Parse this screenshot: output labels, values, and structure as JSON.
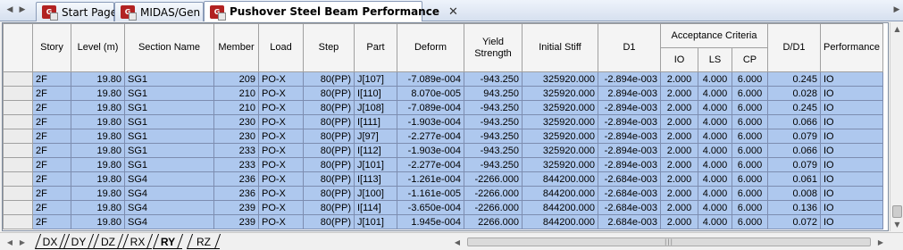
{
  "tabbar": {
    "nav_left": "◀",
    "nav_right": "▶",
    "tabs": [
      {
        "label": "Start Page",
        "icon": "midas-icon",
        "active": false
      },
      {
        "label": "MIDAS/Gen",
        "icon": "midas-icon",
        "active": false
      },
      {
        "label": "Pushover Steel Beam Performance",
        "icon": "midas-icon",
        "active": true
      }
    ],
    "close_glyph": "✕",
    "icon_text": "G"
  },
  "table": {
    "headers": {
      "story": "Story",
      "level": "Level (m)",
      "section": "Section Name",
      "member": "Member",
      "load": "Load",
      "step": "Step",
      "part": "Part",
      "deform": "Deform",
      "yield": "Yield Strength",
      "init_stiff": "Initial Stiff",
      "d1": "D1",
      "acceptance": "Acceptance Criteria",
      "io": "IO",
      "ls": "LS",
      "cp": "CP",
      "dd1": "D/D1",
      "performance": "Performance"
    },
    "rows": [
      [
        "2F",
        "19.80",
        "SG1",
        "209",
        "PO-X",
        "80(PP)",
        "J[107]",
        "-7.089e-004",
        "-943.250",
        "325920.000",
        "-2.894e-003",
        "2.000",
        "4.000",
        "6.000",
        "0.245",
        "IO"
      ],
      [
        "2F",
        "19.80",
        "SG1",
        "210",
        "PO-X",
        "80(PP)",
        "I[110]",
        "8.070e-005",
        "943.250",
        "325920.000",
        "2.894e-003",
        "2.000",
        "4.000",
        "6.000",
        "0.028",
        "IO"
      ],
      [
        "2F",
        "19.80",
        "SG1",
        "210",
        "PO-X",
        "80(PP)",
        "J[108]",
        "-7.089e-004",
        "-943.250",
        "325920.000",
        "-2.894e-003",
        "2.000",
        "4.000",
        "6.000",
        "0.245",
        "IO"
      ],
      [
        "2F",
        "19.80",
        "SG1",
        "230",
        "PO-X",
        "80(PP)",
        "I[111]",
        "-1.903e-004",
        "-943.250",
        "325920.000",
        "-2.894e-003",
        "2.000",
        "4.000",
        "6.000",
        "0.066",
        "IO"
      ],
      [
        "2F",
        "19.80",
        "SG1",
        "230",
        "PO-X",
        "80(PP)",
        "J[97]",
        "-2.277e-004",
        "-943.250",
        "325920.000",
        "-2.894e-003",
        "2.000",
        "4.000",
        "6.000",
        "0.079",
        "IO"
      ],
      [
        "2F",
        "19.80",
        "SG1",
        "233",
        "PO-X",
        "80(PP)",
        "I[112]",
        "-1.903e-004",
        "-943.250",
        "325920.000",
        "-2.894e-003",
        "2.000",
        "4.000",
        "6.000",
        "0.066",
        "IO"
      ],
      [
        "2F",
        "19.80",
        "SG1",
        "233",
        "PO-X",
        "80(PP)",
        "J[101]",
        "-2.277e-004",
        "-943.250",
        "325920.000",
        "-2.894e-003",
        "2.000",
        "4.000",
        "6.000",
        "0.079",
        "IO"
      ],
      [
        "2F",
        "19.80",
        "SG4",
        "236",
        "PO-X",
        "80(PP)",
        "I[113]",
        "-1.261e-004",
        "-2266.000",
        "844200.000",
        "-2.684e-003",
        "2.000",
        "4.000",
        "6.000",
        "0.061",
        "IO"
      ],
      [
        "2F",
        "19.80",
        "SG4",
        "236",
        "PO-X",
        "80(PP)",
        "J[100]",
        "-1.161e-005",
        "-2266.000",
        "844200.000",
        "-2.684e-003",
        "2.000",
        "4.000",
        "6.000",
        "0.008",
        "IO"
      ],
      [
        "2F",
        "19.80",
        "SG4",
        "239",
        "PO-X",
        "80(PP)",
        "I[114]",
        "-3.650e-004",
        "-2266.000",
        "844200.000",
        "-2.684e-003",
        "2.000",
        "4.000",
        "6.000",
        "0.136",
        "IO"
      ],
      [
        "2F",
        "19.80",
        "SG4",
        "239",
        "PO-X",
        "80(PP)",
        "J[101]",
        "1.945e-004",
        "2266.000",
        "844200.000",
        "2.684e-003",
        "2.000",
        "4.000",
        "6.000",
        "0.072",
        "IO"
      ]
    ],
    "row_fill_color": "#aec8ee"
  },
  "sheet_tabs": {
    "nav_left": "◀",
    "nav_right": "▶",
    "items": [
      {
        "label": "DX",
        "active": false
      },
      {
        "label": "DY",
        "active": false
      },
      {
        "label": "DZ",
        "active": false
      },
      {
        "label": "RX",
        "active": false
      },
      {
        "label": "RY",
        "active": true
      },
      {
        "label": "RZ",
        "active": false
      }
    ]
  },
  "scrollbars": {
    "up": "▲",
    "down": "▼",
    "left": "◀",
    "right": "▶",
    "h_grip": "|||"
  }
}
